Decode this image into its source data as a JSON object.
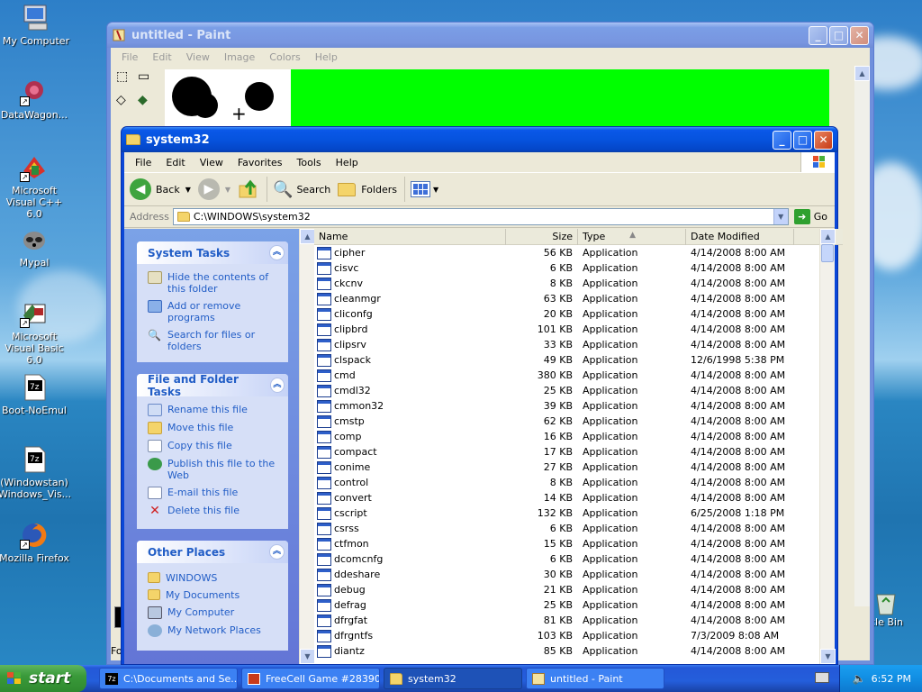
{
  "desktop": {
    "icons": [
      {
        "label": "My Computer"
      },
      {
        "label": "DataWagon..."
      },
      {
        "label": "Microsoft Visual C++ 6.0"
      },
      {
        "label": "Mypal"
      },
      {
        "label": "Microsoft Visual Basic 6.0"
      },
      {
        "label": "Boot-NoEmul"
      },
      {
        "label": "(Windowstan) Windows_Vis..."
      },
      {
        "label": "Mozilla Firefox"
      }
    ],
    "recycle_bin_label": "cle Bin"
  },
  "paint": {
    "title": "untitled - Paint",
    "menu": [
      "File",
      "Edit",
      "View",
      "Image",
      "Colors",
      "Help"
    ],
    "status_fragment": "Fo",
    "canvas_fill_color": "#00ff00"
  },
  "explorer": {
    "title": "system32",
    "menu": [
      "File",
      "Edit",
      "View",
      "Favorites",
      "Tools",
      "Help"
    ],
    "toolbar": {
      "back": "Back",
      "search": "Search",
      "folders": "Folders"
    },
    "address_label": "Address",
    "address_value": "C:\\WINDOWS\\system32",
    "go_label": "Go",
    "system_tasks": {
      "title": "System Tasks",
      "items": [
        "Hide the contents of this folder",
        "Add or remove programs",
        "Search for files or folders"
      ]
    },
    "file_tasks": {
      "title": "File and Folder Tasks",
      "items": [
        "Rename this file",
        "Move this file",
        "Copy this file",
        "Publish this file to the Web",
        "E-mail this file",
        "Delete this file"
      ]
    },
    "other_places": {
      "title": "Other Places",
      "items": [
        "WINDOWS",
        "My Documents",
        "My Computer",
        "My Network Places"
      ]
    },
    "columns": {
      "name": "Name",
      "size": "Size",
      "type": "Type",
      "date": "Date Modified"
    },
    "files": [
      {
        "name": "cipher",
        "size": "56 KB",
        "type": "Application",
        "date": "4/14/2008 8:00 AM"
      },
      {
        "name": "cisvc",
        "size": "6 KB",
        "type": "Application",
        "date": "4/14/2008 8:00 AM"
      },
      {
        "name": "ckcnv",
        "size": "8 KB",
        "type": "Application",
        "date": "4/14/2008 8:00 AM"
      },
      {
        "name": "cleanmgr",
        "size": "63 KB",
        "type": "Application",
        "date": "4/14/2008 8:00 AM"
      },
      {
        "name": "cliconfg",
        "size": "20 KB",
        "type": "Application",
        "date": "4/14/2008 8:00 AM"
      },
      {
        "name": "clipbrd",
        "size": "101 KB",
        "type": "Application",
        "date": "4/14/2008 8:00 AM"
      },
      {
        "name": "clipsrv",
        "size": "33 KB",
        "type": "Application",
        "date": "4/14/2008 8:00 AM"
      },
      {
        "name": "clspack",
        "size": "49 KB",
        "type": "Application",
        "date": "12/6/1998 5:38 PM"
      },
      {
        "name": "cmd",
        "size": "380 KB",
        "type": "Application",
        "date": "4/14/2008 8:00 AM"
      },
      {
        "name": "cmdl32",
        "size": "25 KB",
        "type": "Application",
        "date": "4/14/2008 8:00 AM"
      },
      {
        "name": "cmmon32",
        "size": "39 KB",
        "type": "Application",
        "date": "4/14/2008 8:00 AM"
      },
      {
        "name": "cmstp",
        "size": "62 KB",
        "type": "Application",
        "date": "4/14/2008 8:00 AM"
      },
      {
        "name": "comp",
        "size": "16 KB",
        "type": "Application",
        "date": "4/14/2008 8:00 AM"
      },
      {
        "name": "compact",
        "size": "17 KB",
        "type": "Application",
        "date": "4/14/2008 8:00 AM"
      },
      {
        "name": "conime",
        "size": "27 KB",
        "type": "Application",
        "date": "4/14/2008 8:00 AM"
      },
      {
        "name": "control",
        "size": "8 KB",
        "type": "Application",
        "date": "4/14/2008 8:00 AM"
      },
      {
        "name": "convert",
        "size": "14 KB",
        "type": "Application",
        "date": "4/14/2008 8:00 AM"
      },
      {
        "name": "cscript",
        "size": "132 KB",
        "type": "Application",
        "date": "6/25/2008 1:18 PM"
      },
      {
        "name": "csrss",
        "size": "6 KB",
        "type": "Application",
        "date": "4/14/2008 8:00 AM"
      },
      {
        "name": "ctfmon",
        "size": "15 KB",
        "type": "Application",
        "date": "4/14/2008 8:00 AM"
      },
      {
        "name": "dcomcnfg",
        "size": "6 KB",
        "type": "Application",
        "date": "4/14/2008 8:00 AM"
      },
      {
        "name": "ddeshare",
        "size": "30 KB",
        "type": "Application",
        "date": "4/14/2008 8:00 AM"
      },
      {
        "name": "debug",
        "size": "21 KB",
        "type": "Application",
        "date": "4/14/2008 8:00 AM"
      },
      {
        "name": "defrag",
        "size": "25 KB",
        "type": "Application",
        "date": "4/14/2008 8:00 AM"
      },
      {
        "name": "dfrgfat",
        "size": "81 KB",
        "type": "Application",
        "date": "4/14/2008 8:00 AM"
      },
      {
        "name": "dfrgntfs",
        "size": "103 KB",
        "type": "Application",
        "date": "7/3/2009 8:08 AM"
      },
      {
        "name": "diantz",
        "size": "85 KB",
        "type": "Application",
        "date": "4/14/2008 8:00 AM"
      }
    ]
  },
  "taskbar": {
    "start_label": "start",
    "items": [
      {
        "label": "C:\\Documents and Se..."
      },
      {
        "label": "FreeCell Game #28390"
      },
      {
        "label": "system32"
      },
      {
        "label": "untitled - Paint"
      }
    ],
    "clock": "6:52 PM"
  },
  "colors": {
    "xp_blue": "#0a58e8",
    "panel_link": "#215dc6",
    "start_green": "#3a9a3a"
  }
}
